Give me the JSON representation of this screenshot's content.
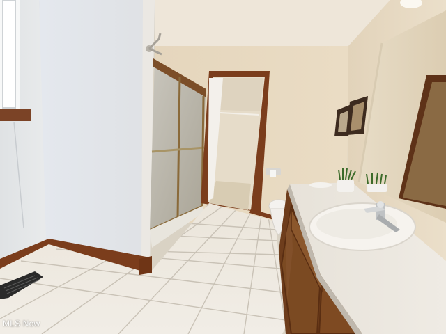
{
  "photo": {
    "subject": "bathroom-interior",
    "watermark": "MLS Now",
    "colors": {
      "wall": "#e6d9c2",
      "ceiling": "#efe6d8",
      "floor_tile": "#ece7de",
      "grout": "#c9c2b6",
      "wood_trim": "#7a3d1a",
      "vanity_wood": "#7b4a22",
      "countertop": "#e9e4dc",
      "shower_glass": "#b9b4a8",
      "shower_frame": "#8a6a3a"
    }
  }
}
